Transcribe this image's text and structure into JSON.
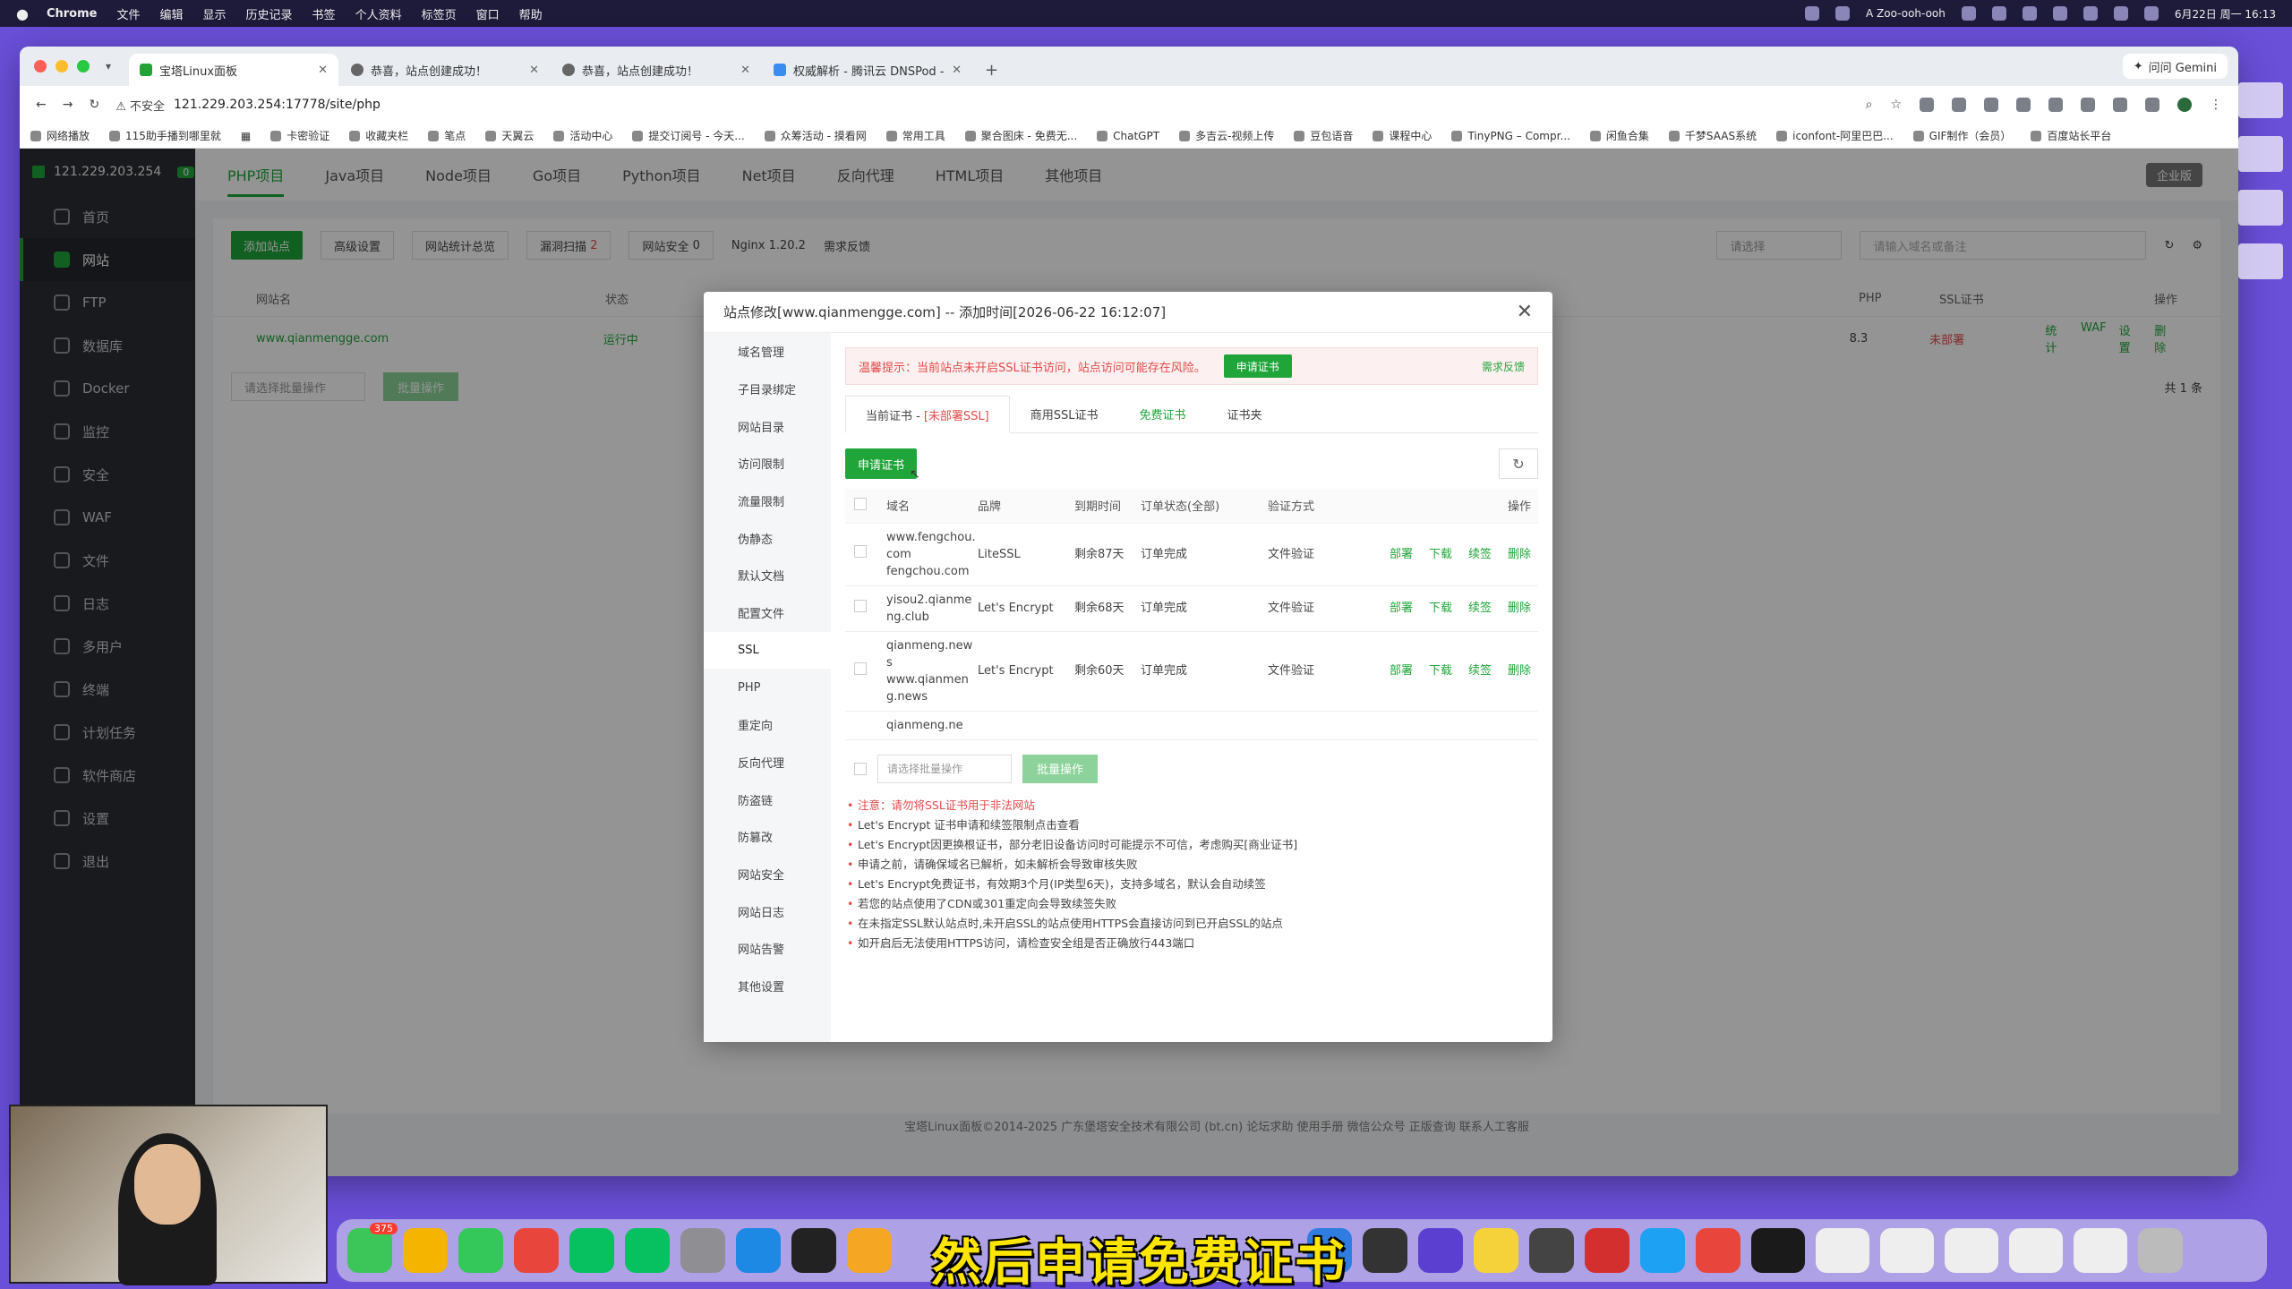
{
  "menubar": {
    "app": "Chrome",
    "items": [
      "文件",
      "编辑",
      "显示",
      "历史记录",
      "书签",
      "个人资料",
      "标签页",
      "窗口",
      "帮助"
    ],
    "user": "A Zoo-ooh-ooh",
    "clock": "6月22日 周一 16:13"
  },
  "browser": {
    "tabs": [
      {
        "title": "宝塔Linux面板"
      },
      {
        "title": "恭喜，站点创建成功！"
      },
      {
        "title": "恭喜，站点创建成功！"
      },
      {
        "title": "权威解析 - 腾讯云 DNSPod - 国"
      }
    ],
    "gemini": "问问 Gemini",
    "insecure": "不安全",
    "url": "121.229.203.254:17778/site/php",
    "bookmarks": [
      "网络播放",
      "115助手播到哪里就",
      "卡密验证",
      "收藏夹栏",
      "笔点",
      "天翼云",
      "活动中心",
      "提交订阅号 - 今天...",
      "众筹活动 - 摸看网",
      "常用工具",
      "聚合图床 - 免费无...",
      "ChatGPT",
      "多吉云-视频上传",
      "豆包语音",
      "课程中心",
      "TinyPNG – Compr...",
      "闲鱼合集",
      "千梦SAAS系统",
      "iconfont-阿里巴巴...",
      "GIF制作（会员）",
      "百度站长平台"
    ]
  },
  "sidebar": {
    "ip": "121.229.203.254",
    "badge": "0",
    "items": [
      "首页",
      "网站",
      "FTP",
      "数据库",
      "Docker",
      "监控",
      "安全",
      "WAF",
      "文件",
      "日志",
      "多用户",
      "终端",
      "计划任务",
      "软件商店",
      "设置",
      "退出"
    ]
  },
  "main": {
    "tabs": [
      "PHP项目",
      "Java项目",
      "Node项目",
      "Go项目",
      "Python项目",
      "Net项目",
      "反向代理",
      "HTML项目",
      "其他项目"
    ],
    "biz": "企业版",
    "add_site": "添加站点",
    "advanced": "高级设置",
    "stats": "网站统计总览",
    "vuln": "漏洞扫描",
    "vuln_count": "2",
    "site_sec": "网站安全",
    "site_sec_count": "0",
    "nginx": "Nginx 1.20.2",
    "feedback": "需求反馈",
    "search_placeholder": "请输入域名或备注",
    "category": "请选择",
    "col_name": "网站名",
    "col_status": "状态",
    "col_php": "PHP",
    "col_ssl": "SSL证书",
    "col_ops": "操作",
    "site": "www.qianmengge.com",
    "site_status": "运行中",
    "php": "8.3",
    "ssl_status": "未部署",
    "ops": [
      "统计",
      "WAF",
      "设置",
      "删除"
    ],
    "batch_sel": "请选择批量操作",
    "batch_btn": "批量操作",
    "pager": "共 1 条",
    "footer": "宝塔Linux面板©2014-2025 广东堡塔安全技术有限公司 (bt.cn)    论坛求助    使用手册    微信公众号    正版查询    联系人工客服"
  },
  "modal": {
    "title": "站点修改[www.qianmengge.com] -- 添加时间[2026-06-22 16:12:07]",
    "nav": [
      "域名管理",
      "子目录绑定",
      "网站目录",
      "访问限制",
      "流量限制",
      "伪静态",
      "默认文档",
      "配置文件",
      "SSL",
      "PHP",
      "重定向",
      "反向代理",
      "防盗链",
      "防篡改",
      "网站安全",
      "网站日志",
      "网站告警",
      "其他设置"
    ],
    "alert": "温馨提示：当前站点未开启SSL证书访问，站点访问可能存在风险。",
    "alert_btn": "申请证书",
    "alert_feedback": "需求反馈",
    "ssl_tabs": {
      "current": "当前证书 -",
      "current_warn": "[未部署SSL]",
      "commercial": "商用SSL证书",
      "free": "免费证书",
      "folder": "证书夹"
    },
    "apply_btn": "申请证书",
    "table": {
      "headers": [
        "域名",
        "品牌",
        "到期时间",
        "订单状态(全部)",
        "验证方式",
        "操作"
      ],
      "rows": [
        {
          "domain": [
            "www.fengchou.com",
            "fengchou.com"
          ],
          "brand": "LiteSSL",
          "expire": "剩余87天",
          "status": "订单完成",
          "verify": "文件验证"
        },
        {
          "domain": [
            "yisou2.qianmeng.club"
          ],
          "brand": "Let's Encrypt",
          "expire": "剩余68天",
          "status": "订单完成",
          "verify": "文件验证"
        },
        {
          "domain": [
            "qianmeng.news",
            "www.qianmeng.news"
          ],
          "brand": "Let's Encrypt",
          "expire": "剩余60天",
          "status": "订单完成",
          "verify": "文件验证"
        },
        {
          "domain": [
            "qianmeng.ne"
          ],
          "brand": "",
          "expire": "",
          "status": "",
          "verify": ""
        }
      ],
      "ops": [
        "部署",
        "下载",
        "续签",
        "删除"
      ]
    },
    "batch_sel": "请选择批量操作",
    "batch_btn": "批量操作",
    "notes": [
      "注意：请勿将SSL证书用于非法网站",
      "Let's Encrypt 证书申请和续签限制点击查看",
      "Let's Encrypt因更换根证书，部分老旧设备访问时可能提示不可信，考虑购买[商业证书]",
      "申请之前，请确保域名已解析，如未解析会导致审核失败",
      "Let's Encrypt免费证书，有效期3个月(IP类型6天)，支持多域名，默认会自动续签",
      "若您的站点使用了CDN或301重定向会导致续签失败",
      "在未指定SSL默认站点时,未开启SSL的站点使用HTTPS会直接访问到已开启SSL的站点",
      "如开启后无法使用HTTPS访问，请检查安全组是否正确放行443端口"
    ]
  },
  "caption": "然后申请免费证书",
  "dock_badge": "375"
}
